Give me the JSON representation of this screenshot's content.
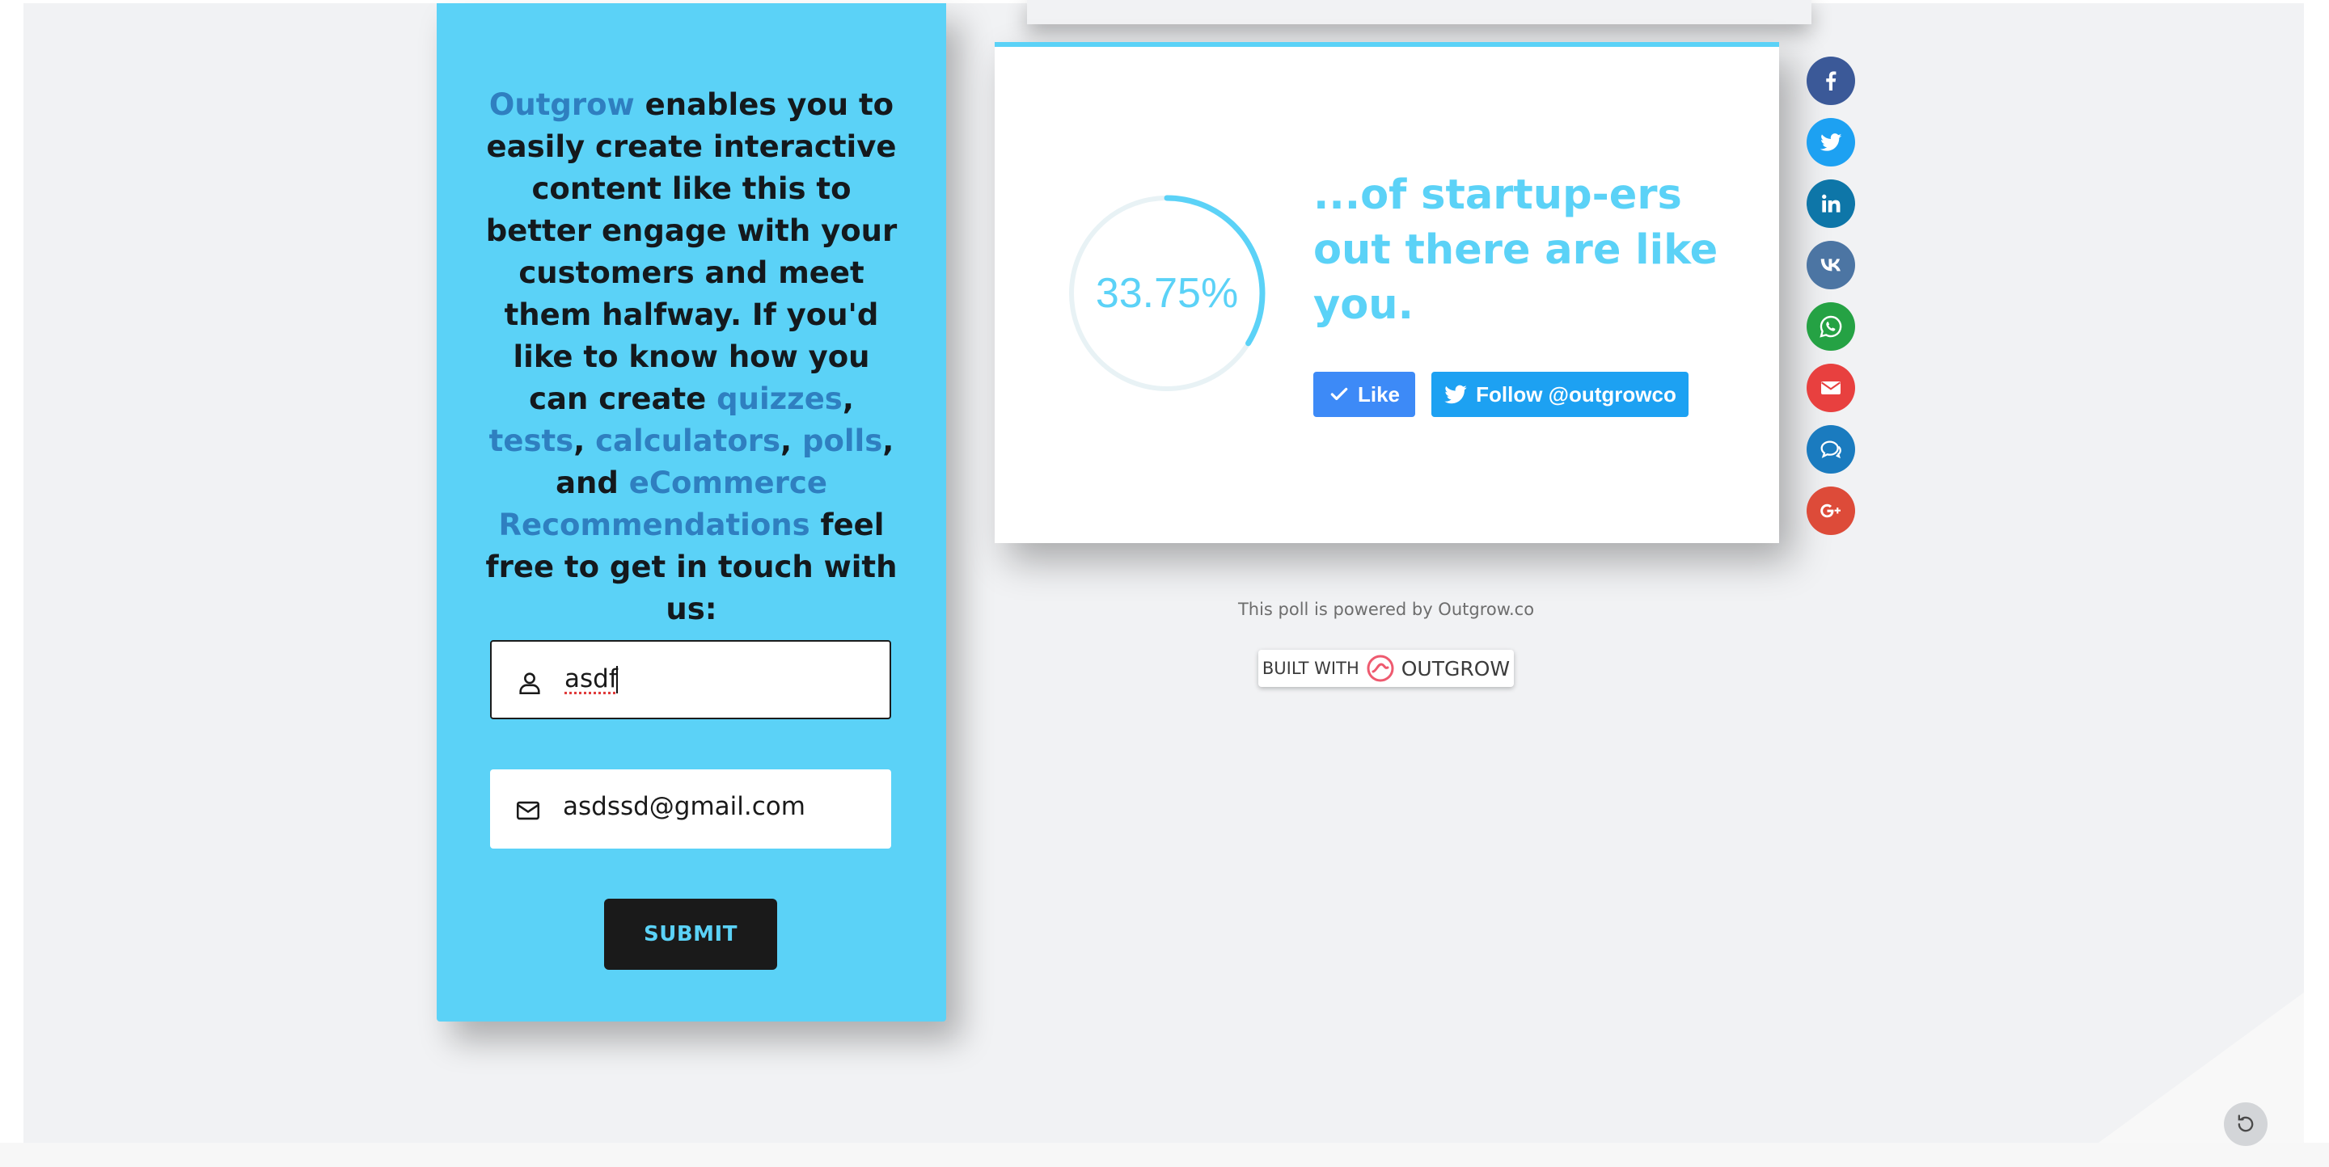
{
  "lead_form": {
    "text_parts": [
      {
        "text": "Outgrow",
        "highlight": true
      },
      {
        "text": " enables you to easily create interactive content like this to better engage with your customers and meet them halfway. If you'd like to know how you can create ",
        "highlight": false
      },
      {
        "text": "quizzes",
        "highlight": true
      },
      {
        "text": ", ",
        "highlight": false
      },
      {
        "text": "tests",
        "highlight": true
      },
      {
        "text": ", ",
        "highlight": false
      },
      {
        "text": "calculators",
        "highlight": true
      },
      {
        "text": ", ",
        "highlight": false
      },
      {
        "text": "polls",
        "highlight": true
      },
      {
        "text": ", and ",
        "highlight": false
      },
      {
        "text": "eCommerce Recommendations",
        "highlight": true
      },
      {
        "text": " feel free to get in touch with us:",
        "highlight": false
      }
    ],
    "name_field": {
      "value": "asdf",
      "icon": "user-icon"
    },
    "email_field": {
      "value": "asdssd@gmail.com",
      "icon": "mail-icon"
    },
    "submit_label": "SUBMIT"
  },
  "result": {
    "percent_label": "33.75%",
    "percent_value": 33.75,
    "heading": "...of startup-ers out there are like you.",
    "like_label": "Like",
    "follow_label": "Follow @outgrowco"
  },
  "share_buttons": [
    {
      "name": "facebook",
      "color": "#3b5998"
    },
    {
      "name": "twitter",
      "color": "#1da1f2"
    },
    {
      "name": "linkedin",
      "color": "#0e76a8"
    },
    {
      "name": "vk",
      "color": "#4c75a3"
    },
    {
      "name": "whatsapp",
      "color": "#25a244"
    },
    {
      "name": "email",
      "color": "#e8403f"
    },
    {
      "name": "comments",
      "color": "#1a7bbf"
    },
    {
      "name": "google-plus",
      "color": "#dd4b39"
    }
  ],
  "footer": {
    "powered_text": "This poll is powered by Outgrow.co",
    "built_with": "BUILT WITH",
    "brand": "OUTGROW"
  },
  "colors": {
    "accent": "#5bd2f7",
    "link": "#2f7fc0",
    "dark": "#1a1a1a"
  }
}
